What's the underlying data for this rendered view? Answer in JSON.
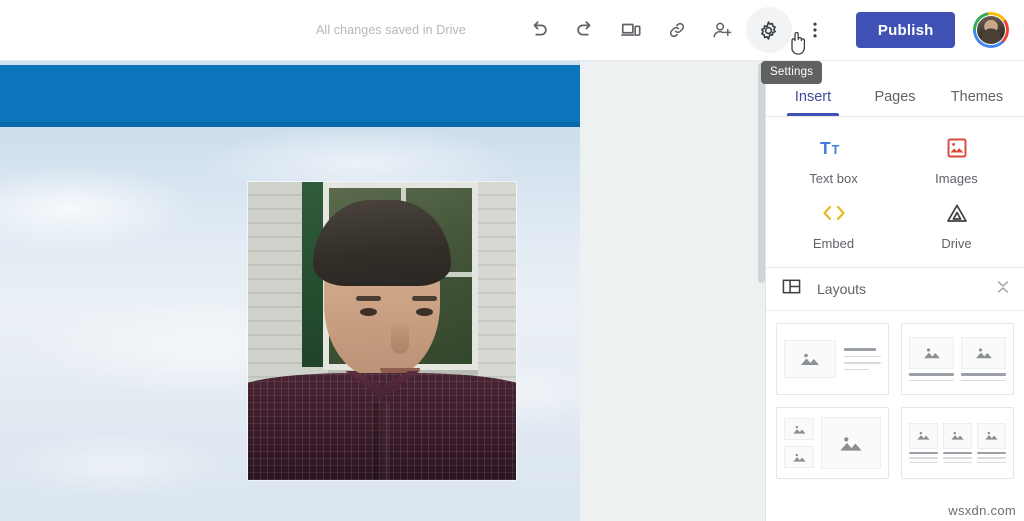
{
  "topbar": {
    "save_status": "All changes saved in Drive",
    "undo_label": "Undo",
    "redo_label": "Redo",
    "preview_label": "Preview",
    "link_label": "Copy link",
    "share_label": "Add people",
    "settings_label": "Settings",
    "more_label": "More",
    "publish_label": "Publish",
    "avatar_label": "Account"
  },
  "tooltip": {
    "text": "Settings"
  },
  "panel": {
    "tabs": [
      {
        "label": "Insert",
        "active": true
      },
      {
        "label": "Pages",
        "active": false
      },
      {
        "label": "Themes",
        "active": false
      }
    ],
    "insert_items": [
      {
        "label": "Text box",
        "icon": "text-box-icon",
        "color": "#3f7fd4"
      },
      {
        "label": "Images",
        "icon": "images-icon",
        "color": "#d9493d"
      },
      {
        "label": "Embed",
        "icon": "embed-code-icon",
        "color": "#e8b81f"
      },
      {
        "label": "Drive",
        "icon": "drive-icon",
        "color": "#3c4043"
      }
    ],
    "layouts_section": {
      "title": "Layouts",
      "icon": "layouts-grid-icon",
      "collapse_icon": "collapse-chevrons-icon"
    },
    "layouts": [
      {
        "name": "layout-image-left-text-right"
      },
      {
        "name": "layout-two-images-with-captions"
      },
      {
        "name": "layout-two-small-one-large-image"
      },
      {
        "name": "layout-three-columns-image-text"
      }
    ]
  },
  "canvas": {
    "banner_color": "#0b74ba",
    "page_background": "sky-with-clouds",
    "photo_alt": "portrait-photo-of-man-in-front-of-house",
    "scrollbar": "vertical-scrollbar"
  },
  "watermark": {
    "text": "wsxdn.com"
  },
  "colors": {
    "accent": "#3f51b5",
    "banner": "#0b74ba",
    "tooltip_bg": "#616161",
    "canvas_bg": "#eef1f2"
  }
}
